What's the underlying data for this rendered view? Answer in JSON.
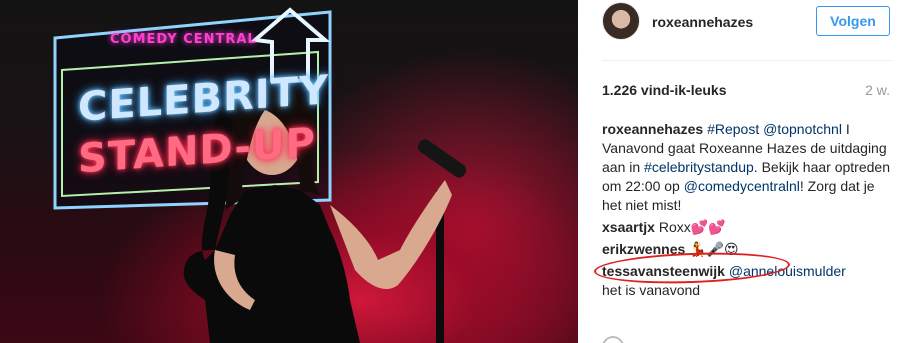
{
  "photo": {
    "sign_brand": "COMEDY CENTRAL",
    "sign_line1": "CELEBRITY",
    "sign_line2": "STAND-UP"
  },
  "post": {
    "username": "roxeannehazes",
    "follow_label": "Volgen",
    "likes": "1.226 vind-ik-leuks",
    "age": "2 w."
  },
  "caption": {
    "user": "roxeannehazes",
    "hashtag_repost": "#Repost",
    "mention_topnotch": "@topnotchnl",
    "text1": " I Vanavond gaat Roxeanne Hazes de uitdaging aan in ",
    "hashtag_celeb": "#celebritystandup",
    "text2": ". Bekijk haar optreden om 22:00 op ",
    "mention_comedy": "@comedycentralnl",
    "text3": "! Zorg dat je het niet mist!"
  },
  "comments": [
    {
      "user": "xsaartjx",
      "text": "Roxx💕💕"
    },
    {
      "user": "erikzwennes",
      "text": "💃🎤😍"
    },
    {
      "user": "tessavansteenwijk",
      "mention": "@annelouismulder",
      "text": "het is vanavond"
    }
  ],
  "colors": {
    "follow_blue": "#3897f0",
    "link_blue": "#003569",
    "annotation_red": "#e02020"
  },
  "icons": {
    "like": "heart-outline-icon"
  }
}
